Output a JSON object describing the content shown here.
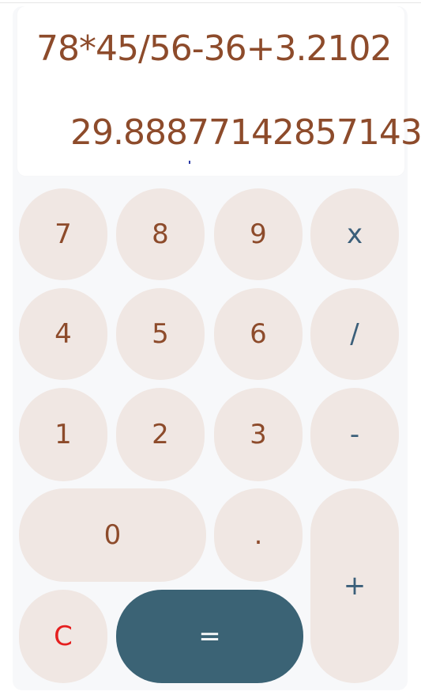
{
  "display": {
    "expression": "78*45/56-36+3.2102",
    "result": "29.88877142857143"
  },
  "keys": {
    "k7": "7",
    "k8": "8",
    "k9": "9",
    "multiply": "x",
    "k4": "4",
    "k5": "5",
    "k6": "6",
    "divide": "/",
    "k1": "1",
    "k2": "2",
    "k3": "3",
    "subtract": "-",
    "k0": "0",
    "decimal": ".",
    "add": "+",
    "clear": "C",
    "equals": "="
  },
  "colors": {
    "digit_text": "#8d4b2b",
    "operator_text": "#3b5f7a",
    "clear_text": "#e51f1f",
    "key_bg": "#f0e7e3",
    "equals_bg": "#3b6375",
    "panel_bg": "#f7f8fa"
  }
}
